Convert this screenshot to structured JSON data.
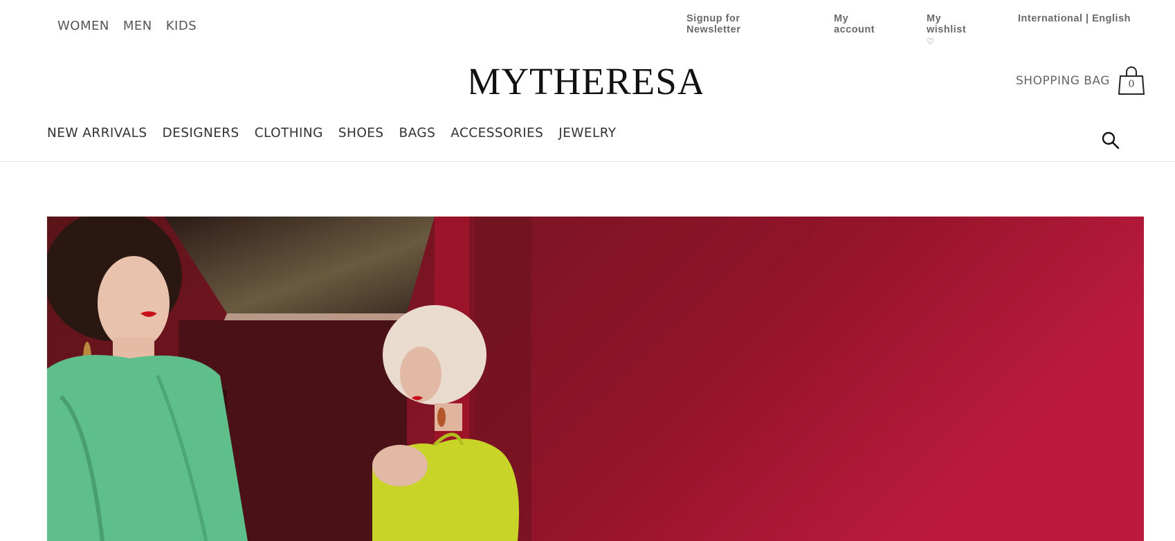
{
  "top_nav": {
    "women": "WOMEN",
    "men": "MEN",
    "kids": "KIDS"
  },
  "utility": {
    "newsletter": "Signup for Newsletter",
    "account": "My account",
    "wishlist": "My wishlist",
    "wishlist_icon": "♡",
    "region": "International | English"
  },
  "logo": {
    "text": "MYTHERESA"
  },
  "bag": {
    "label": "SHOPPING BAG",
    "count": "0"
  },
  "main_nav": [
    "NEW ARRIVALS",
    "DESIGNERS",
    "CLOTHING",
    "SHOES",
    "BAGS",
    "ACCESSORIES",
    "JEWELRY"
  ],
  "icons": {
    "search": "search-icon",
    "bag": "shopping-bag-icon",
    "heart": "heart-icon"
  },
  "colors": {
    "text": "#333333",
    "hero_red": "#9b1530",
    "dress_green": "#5fc08a",
    "dress_lime": "#c9d428"
  }
}
